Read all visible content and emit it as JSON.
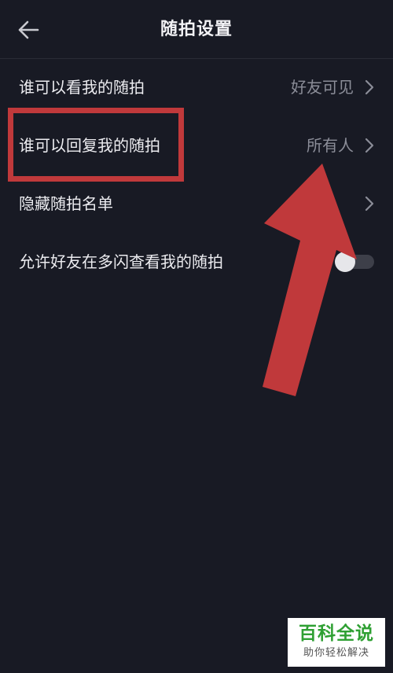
{
  "header": {
    "title": "随拍设置",
    "back_icon": "arrow-left-icon"
  },
  "settings": {
    "rows": [
      {
        "label": "谁可以看我的随拍",
        "value": "好友可见",
        "icon": "chevron-right-icon"
      },
      {
        "label": "谁可以回复我的随拍",
        "value": "所有人",
        "icon": "chevron-right-icon"
      },
      {
        "label": "隐藏随拍名单",
        "value": "",
        "icon": "chevron-right-icon"
      },
      {
        "label": "允许好友在多闪查看我的随拍",
        "toggle_on": false
      }
    ]
  },
  "annotation": {
    "box_color": "#c0393b",
    "arrow_color": "#c0393b"
  },
  "watermark": {
    "title": "百科全说",
    "subtitle": "助你轻松解决"
  },
  "colors": {
    "background": "#181a24",
    "text_primary": "#ececf0",
    "text_secondary": "#8b8d98",
    "watermark_green": "#2fa033"
  }
}
